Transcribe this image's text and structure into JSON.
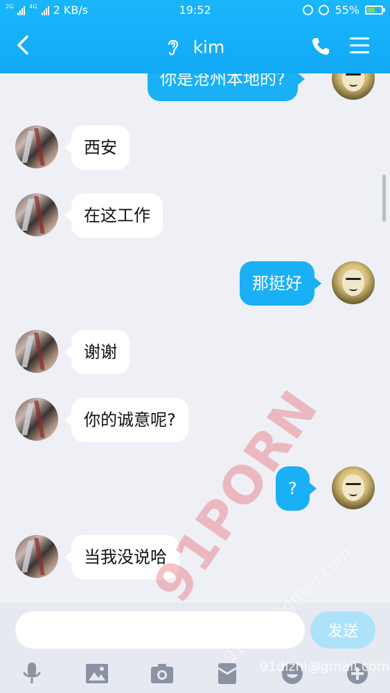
{
  "status_bar": {
    "signal1_label": "2G",
    "signal2_label": "4G",
    "net_speed": "2 KB/s",
    "time": "19:52",
    "battery": "55%",
    "battery_level": 0.55
  },
  "header": {
    "title": "kim",
    "icons": [
      "back-arrow-icon",
      "ear-icon",
      "phone-icon",
      "menu-icon"
    ]
  },
  "messages": [
    {
      "side": "out",
      "text": "你是沧州本地的?"
    },
    {
      "side": "in",
      "text": "西安"
    },
    {
      "side": "in",
      "text": "在这工作"
    },
    {
      "side": "out",
      "text": "那挺好"
    },
    {
      "side": "in",
      "text": "谢谢"
    },
    {
      "side": "in",
      "text": "你的诚意呢?"
    },
    {
      "side": "out",
      "text": "?"
    },
    {
      "side": "in",
      "text": "当我没说哈"
    }
  ],
  "input": {
    "placeholder": "",
    "value": "",
    "send_label": "发送"
  },
  "toolbar_icons": [
    "microphone-icon",
    "image-icon",
    "camera-icon",
    "red-packet-icon",
    "emoji-icon",
    "plus-icon"
  ],
  "watermark": {
    "main": "91PORN",
    "email1": "91dizhi@gmail.com",
    "email2": "91dizhi@gmail.com"
  },
  "colors": {
    "header_blue": "#19b6fb",
    "outgoing_bubble": "#1ab0f5",
    "incoming_bubble": "#ffffff",
    "chat_background": "#eef0f6",
    "send_button": "#aee2fb"
  }
}
